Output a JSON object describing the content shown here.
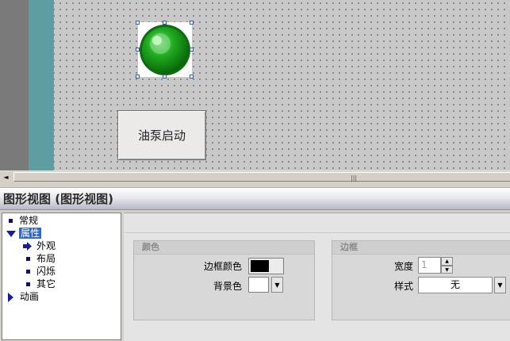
{
  "canvas": {
    "pump_button_label": "油泵启动",
    "lamp_color": "#1faa1f"
  },
  "scrollbar": {
    "left_arrow": "◄",
    "grip": "|||"
  },
  "panel": {
    "title": "图形视图 (图形视图)"
  },
  "tree": {
    "items": [
      {
        "label": "常规"
      },
      {
        "label": "属性"
      },
      {
        "label": "外观"
      },
      {
        "label": "布局"
      },
      {
        "label": "闪烁"
      },
      {
        "label": "其它"
      },
      {
        "label": "动画"
      }
    ]
  },
  "color_group": {
    "title": "颜色",
    "border_color_label": "边框颜色",
    "border_color_value": "#000000",
    "background_label": "背景色",
    "background_value": "#ffffff",
    "dropdown_arrow": "▼"
  },
  "border_group": {
    "title": "边框",
    "width_label": "宽度",
    "width_value": "1",
    "style_label": "样式",
    "style_value": "无",
    "spin_up": "▲",
    "spin_down": "▼",
    "dropdown_arrow": "▼"
  }
}
